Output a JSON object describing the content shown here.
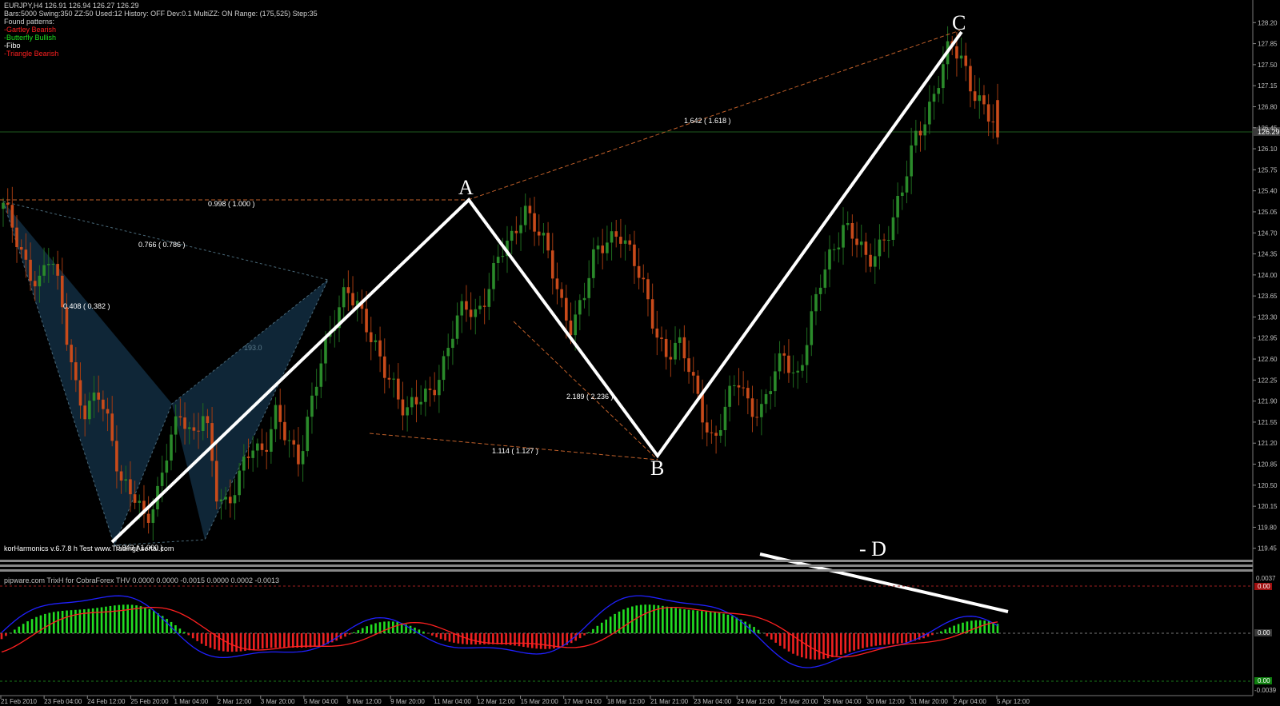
{
  "header": {
    "line1": "EURJPY,H4  126.91 126.94 126.27 126.29",
    "line2": "Bars:5000  Swing:350  ZZ:50  Used:12  History: OFF Dev:0.1  MultiZZ: ON  Range: (175,525)  Step:35",
    "found_label": "Found patterns:",
    "patterns": [
      {
        "label": "-Gartley Bearish",
        "color": "#ff2020"
      },
      {
        "label": "-Butterfly Bullish",
        "color": "#20e020"
      },
      {
        "label": "-Fibo",
        "color": "#ffffff"
      },
      {
        "label": "-Triangle Bearish",
        "color": "#ff2020"
      }
    ]
  },
  "footer_main": "korHarmonics v.6.7.8 h Test www.TradingAsertal.com",
  "indicator": {
    "title": "pipware.com TrixH for CobraForex THV  0.0000 0.0000 -0.0015 0.0000 0.0002 -0.0013",
    "axis_labels": [
      "0.0037",
      "0.00",
      "0.00",
      "0.00",
      "-0.0039"
    ]
  },
  "chart_data": {
    "type": "candlestick",
    "symbol": "EURJPY",
    "timeframe": "H4",
    "ohlc_current": {
      "open": 126.91,
      "high": 126.94,
      "low": 126.27,
      "close": 126.29
    },
    "current_price_label": "126.29",
    "ylim": [
      119.3,
      128.35
    ],
    "y_ticks": [
      "128.20",
      "127.85",
      "127.50",
      "127.15",
      "126.80",
      "126.45",
      "126.10",
      "125.75",
      "125.40",
      "125.05",
      "124.70",
      "124.35",
      "124.00",
      "123.65",
      "123.30",
      "122.95",
      "122.60",
      "122.25",
      "121.90",
      "121.55",
      "121.20",
      "120.85",
      "120.50",
      "120.15",
      "119.80",
      "119.45"
    ],
    "x_ticks": [
      "21 Feb 2010",
      "23 Feb 04:00",
      "24 Feb 12:00",
      "25 Feb 20:00",
      "1 Mar 04:00",
      "2 Mar 12:00",
      "3 Mar 20:00",
      "5 Mar 04:00",
      "8 Mar 12:00",
      "9 Mar 20:00",
      "11 Mar 04:00",
      "12 Mar 12:00",
      "15 Mar 20:00",
      "17 Mar 04:00",
      "18 Mar 12:00",
      "21 Mar 21:00",
      "23 Mar 04:00",
      "24 Mar 12:00",
      "25 Mar 20:00",
      "29 Mar 04:00",
      "30 Mar 12:00",
      "31 Mar 20:00",
      "2 Apr 04:00",
      "5 Apr 12:00"
    ],
    "swing_points": [
      {
        "label": "A",
        "price": 125.2
      },
      {
        "label": "B",
        "price": 121.1
      },
      {
        "label": "C",
        "price": 127.9
      },
      {
        "label": "- D",
        "price": null
      }
    ],
    "fib_labels": [
      "0.998 ( 1.000 )",
      "0.766 ( 0.786 )",
      "0.408 ( 0.382 )",
      "193.0",
      "0.943 ( 1.000 )",
      "1.642 ( 1.618 )",
      "2.189 ( 2.236 )",
      "1.114 ( 1.127 )"
    ],
    "candle_path": [
      125.1,
      124.7,
      124.2,
      123.8,
      124.3,
      123.5,
      122.3,
      121.6,
      122.0,
      121.5,
      120.6,
      120.3,
      119.8,
      120.4,
      121.3,
      121.6,
      121.2,
      121.9,
      120.4,
      120.0,
      120.7,
      121.3,
      121.0,
      121.6,
      121.3,
      121.0,
      121.8,
      122.6,
      123.3,
      123.9,
      123.4,
      122.9,
      122.6,
      122.2,
      121.6,
      121.9,
      122.1,
      122.4,
      123.0,
      123.5,
      123.4,
      123.8,
      124.3,
      124.6,
      125.2,
      124.8,
      124.3,
      123.6,
      123.2,
      123.6,
      124.3,
      124.6,
      124.8,
      124.3,
      123.8,
      123.2,
      122.7,
      122.8,
      122.4,
      121.8,
      121.2,
      121.7,
      122.3,
      121.9,
      121.7,
      122.2,
      122.7,
      122.3,
      123.0,
      123.8,
      124.4,
      124.9,
      124.6,
      124.1,
      124.5,
      124.9,
      125.4,
      126.2,
      126.7,
      127.3,
      127.8,
      127.5,
      127.1,
      126.8,
      126.3
    ]
  }
}
